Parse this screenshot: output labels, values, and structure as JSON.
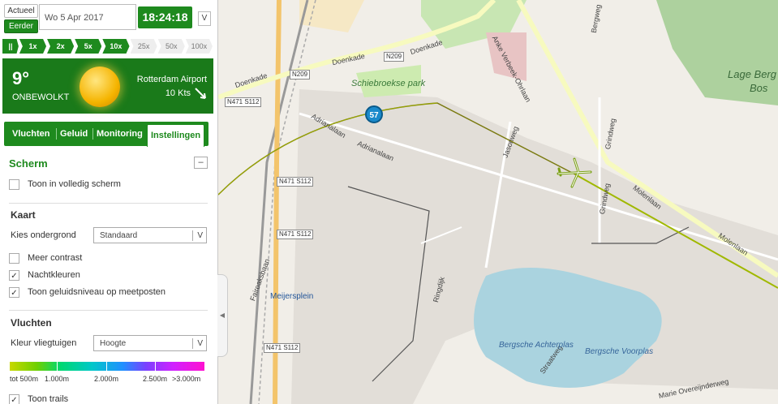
{
  "time_controls": {
    "mode_current": "Actueel",
    "mode_past": "Eerder",
    "date": "Wo 5 Apr 2017",
    "time": "18:24:18",
    "time_chevron": "V"
  },
  "speed": {
    "items": [
      "||",
      "1x",
      "2x",
      "5x",
      "10x",
      "25x",
      "50x",
      "100x"
    ],
    "active": "10x"
  },
  "weather": {
    "temperature": "9°",
    "condition": "ONBEWOLKT",
    "station": "Rotterdam Airport",
    "wind": "10 Kts",
    "icon": "sun-icon"
  },
  "tabs": {
    "flights": "Vluchten",
    "noise": "Geluid",
    "monitoring": "Monitoring",
    "settings": "Instellingen",
    "active": "Instellingen"
  },
  "screen_section": {
    "title": "Scherm",
    "collapse": "–",
    "fullscreen_label": "Toon in volledig scherm",
    "fullscreen_checked": false
  },
  "map_section": {
    "title": "Kaart",
    "background_label": "Kies ondergrond",
    "background_value": "Standaard",
    "contrast_label": "Meer contrast",
    "contrast_checked": false,
    "night_label": "Nachtkleuren",
    "night_checked": true,
    "noise_label": "Toon geluidsniveau op meetposten",
    "noise_checked": true
  },
  "flights_section": {
    "title": "Vluchten",
    "color_label": "Kleur vliegtuigen",
    "color_value": "Hoogte",
    "legend": [
      "tot 500m",
      "1.000m",
      "2.000m",
      "2.500m",
      ">3.000m"
    ],
    "trails_label": "Toon trails",
    "trails_checked": true,
    "chevron": "V"
  },
  "map": {
    "labels": {
      "doenkade1": "Doenkade",
      "doenkade2": "Doenkade",
      "doenkade3": "Doenkade",
      "n209a": "N209",
      "n209b": "N209",
      "schiebroekse": "Schiebroekse park",
      "lage_berg": "Lage Berg",
      "bos": "Bos",
      "adrianalaan1": "Adrianalaan",
      "adrianalaan2": "Adrianalaan",
      "jasonweg": "Jasonweg",
      "grindweg": "Grindweg",
      "molenlaan1": "Molenlaan",
      "molenlaan2": "Molenlaan",
      "meijersplein": "Meijersplein",
      "fairoaksbaan": "Fairoaksbaan",
      "ringdijk": "Ringdijk",
      "straatweg": "Straatweg",
      "bergsche_achterplas": "Bergsche Achterplas",
      "bergsche_voorplas": "Bergsche Voorplas",
      "marie_overeijnder": "Marie Overeijnderweg",
      "bergweg": "Bergweg",
      "anke_verbeek": "Anke Verbeek-Ohrlaan",
      "n471_s112": "N471 S112"
    },
    "meetpost_value": "57"
  },
  "icons": {
    "panel_handle": "chevron-left-icon",
    "plane": "airplane-icon",
    "wind_arrow": "wind-arrow-icon"
  }
}
